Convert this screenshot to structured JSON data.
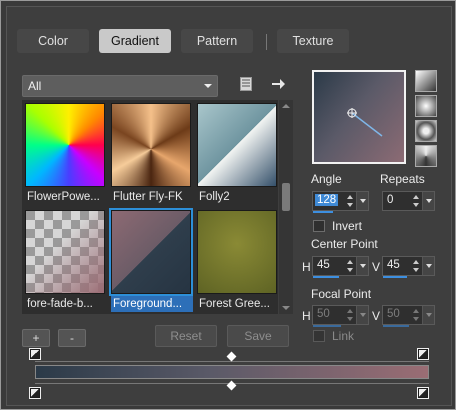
{
  "tabs": [
    {
      "label": "Color",
      "active": false
    },
    {
      "label": "Gradient",
      "active": true
    },
    {
      "label": "Pattern",
      "active": false
    },
    {
      "label": "Texture",
      "active": false
    }
  ],
  "category": {
    "value": "All"
  },
  "toolbar_icons": [
    "document-icon",
    "right-arrow-icon"
  ],
  "swatches": [
    {
      "name": "FlowerPowe...",
      "selected": false
    },
    {
      "name": "Flutter Fly-FK",
      "selected": false
    },
    {
      "name": "Folly2",
      "selected": false
    },
    {
      "name": "fore-fade-b...",
      "selected": false
    },
    {
      "name": "Foreground...",
      "selected": true
    },
    {
      "name": "Forest Gree...",
      "selected": false
    }
  ],
  "buttons": {
    "add": "+",
    "remove": "-",
    "reset": "Reset",
    "save": "Save"
  },
  "angle": {
    "label": "Angle",
    "value": "128"
  },
  "repeats": {
    "label": "Repeats",
    "value": "0"
  },
  "invert": {
    "label": "Invert",
    "checked": false
  },
  "center_point": {
    "label": "Center Point",
    "h_label": "H",
    "h": "45",
    "v_label": "V",
    "v": "45"
  },
  "focal_point": {
    "label": "Focal Point",
    "h_label": "H",
    "h": "50",
    "v_label": "V",
    "v": "50"
  },
  "link": {
    "label": "Link",
    "checked": false
  },
  "gradient_colors": {
    "start": "#2b3a48",
    "end": "#9a6d74"
  }
}
